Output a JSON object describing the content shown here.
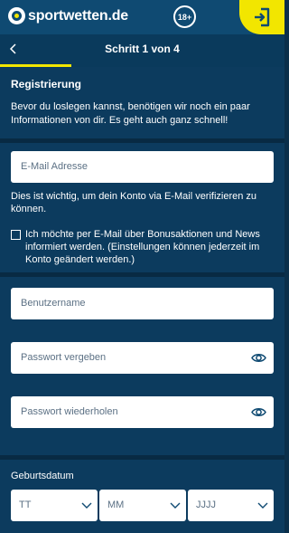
{
  "header": {
    "brand_name": "sportwetten",
    "brand_tld": ".de",
    "age_badge": "18+",
    "login_icon": "login-arrow-icon"
  },
  "stepbar": {
    "back_icon": "chevron-left-icon",
    "title": "Schritt 1 von 4",
    "progress_fraction": 0.25
  },
  "intro": {
    "title": "Registrierung",
    "text": "Bevor du loslegen kannst, benötigen wir noch ein paar Informationen von dir. Es geht auch ganz schnell!"
  },
  "email": {
    "placeholder": "E-Mail Adresse",
    "hint": "Dies ist wichtig, um dein Konto via E-Mail verifizieren zu können.",
    "newsletter_label": "Ich möchte per E-Mail über Bonusaktionen und News informiert werden. (Einstellungen können jederzeit im Konto geändert werden.)",
    "newsletter_checked": false
  },
  "account": {
    "username_placeholder": "Benutzername",
    "password_placeholder": "Passwort vergeben",
    "password_repeat_placeholder": "Passwort wiederholen",
    "eye_icon": "eye-icon"
  },
  "birthdate": {
    "label": "Geburtsdatum",
    "day": "TT",
    "month": "MM",
    "year": "JJJJ"
  },
  "colors": {
    "header": "#0f4a72",
    "background": "#0a2f4a",
    "section": "#0c3b5e",
    "accent": "#f2e600",
    "field": "#ffffff",
    "placeholder": "#5b7084"
  }
}
